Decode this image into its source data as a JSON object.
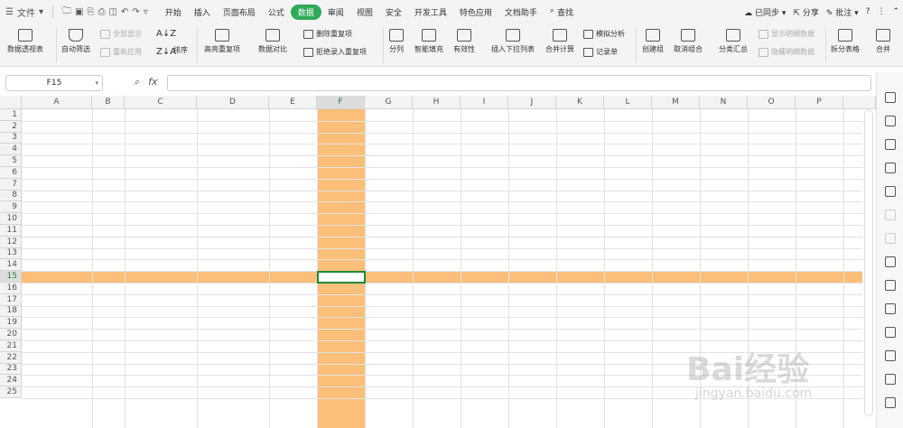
{
  "menubar": {
    "file_label": "文件",
    "tabs": [
      "开始",
      "插入",
      "页面布局",
      "公式",
      "数据",
      "审阅",
      "视图",
      "安全",
      "开发工具",
      "特色应用",
      "文档助手"
    ],
    "active_tab": "数据",
    "search_label": "查找",
    "sync_label": "已同步",
    "share_label": "分享",
    "annotate_label": "批注"
  },
  "ribbon": {
    "pivot": "数据透视表",
    "autofilter": "自动筛选",
    "show_all": "全部显示",
    "reapply": "重新应用",
    "sort": "排序",
    "highlight_dup": "高亮重复项",
    "data_compare": "数据对比",
    "remove_dup": "删除重复项",
    "reject_dup": "拒绝录入重复项",
    "split_col": "分列",
    "smart_fill": "智能填充",
    "validity": "有效性",
    "insert_dropdown": "插入下拉列表",
    "consolidate": "合并计算",
    "what_if": "模拟分析",
    "record": "记录单",
    "group": "创建组",
    "ungroup": "取消组合",
    "subtotal": "分类汇总",
    "show_detail": "显示明细数据",
    "hide_detail": "隐藏明细数据",
    "split_table": "拆分表格",
    "merge": "合并"
  },
  "formula": {
    "namebox": "F15",
    "fx": "fx"
  },
  "grid": {
    "columns": [
      "A",
      "B",
      "C",
      "D",
      "E",
      "F",
      "G",
      "H",
      "I",
      "J",
      "K",
      "L",
      "M",
      "N",
      "O",
      "P"
    ],
    "rows": [
      "1",
      "2",
      "3",
      "4",
      "5",
      "6",
      "7",
      "8",
      "9",
      "10",
      "11",
      "12",
      "13",
      "14",
      "15",
      "16",
      "17",
      "18",
      "19",
      "20",
      "21",
      "22",
      "23",
      "24",
      "25"
    ],
    "selected_col": "F",
    "selected_row": "15",
    "highlight_color": "#fbbf7a"
  },
  "watermark": {
    "brand": "Bai经验",
    "url": "jingyan.baidu.com"
  }
}
